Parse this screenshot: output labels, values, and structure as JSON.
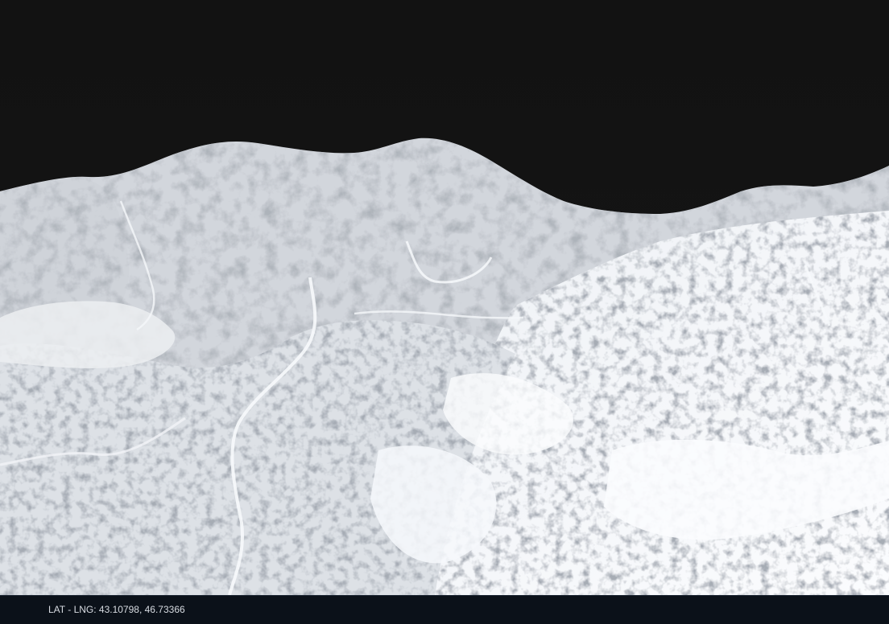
{
  "scene": {
    "sky_color": "#121212",
    "terrain_highlight_color": "#f4f6fa",
    "terrain_shadow_color": "#6e737c"
  },
  "statusbar": {
    "coordinates_text": "LAT - LNG: 43.10798, 46.73366",
    "background_color": "#0b1119"
  }
}
